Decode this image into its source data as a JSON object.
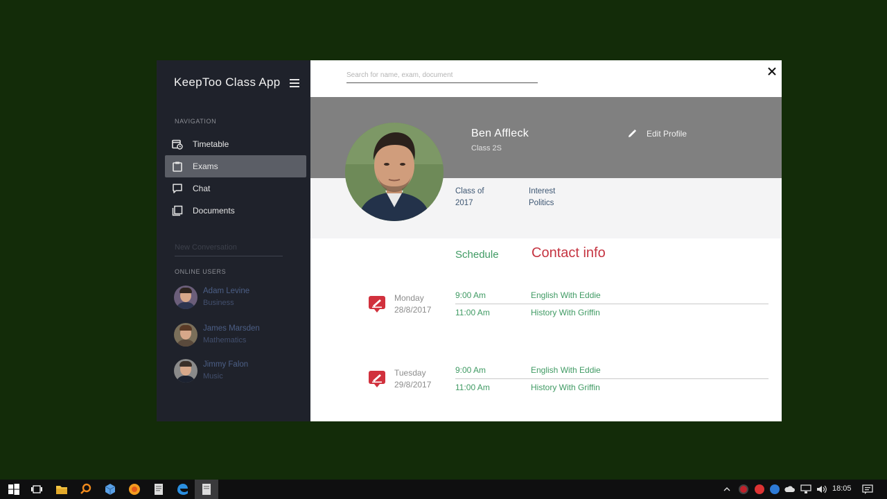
{
  "app": {
    "title": "KeepToo Class App",
    "menu_icon": "hamburger-icon",
    "close_icon": "close-icon"
  },
  "sidebar": {
    "nav_heading": "NAVIGATION",
    "items": [
      {
        "label": "Timetable",
        "icon": "calendar-clock-icon",
        "active": false
      },
      {
        "label": "Exams",
        "icon": "clipboard-icon",
        "active": true
      },
      {
        "label": "Chat",
        "icon": "chat-bubble-icon",
        "active": false
      },
      {
        "label": "Documents",
        "icon": "documents-icon",
        "active": false
      }
    ],
    "new_conversation_placeholder": "New Conversation",
    "online_heading": "ONLINE USERS",
    "users": [
      {
        "name": "Adam Levine",
        "subject": "Business"
      },
      {
        "name": "James Marsden",
        "subject": "Mathematics"
      },
      {
        "name": "Jimmy Falon",
        "subject": "Music"
      }
    ]
  },
  "search": {
    "placeholder": "Search for name, exam, document"
  },
  "profile": {
    "name": "Ben Affleck",
    "class": "Class 2S",
    "edit_label": "Edit Profile",
    "class_of_label": "Class of",
    "class_of_value": "2017",
    "interest_label": "Interest",
    "interest_value": "Politics"
  },
  "tabs": {
    "schedule": "Schedule",
    "contact": "Contact info"
  },
  "schedule": [
    {
      "day": "Monday",
      "date": "28/8/2017",
      "slots": [
        {
          "time": "9:00 Am",
          "subject": "English With Eddie"
        },
        {
          "time": "11:00 Am",
          "subject": "History With Griffin"
        }
      ]
    },
    {
      "day": "Tuesday",
      "date": "29/8/2017",
      "slots": [
        {
          "time": "9:00 Am",
          "subject": "English With Eddie"
        },
        {
          "time": "11:00 Am",
          "subject": "History With Griffin"
        }
      ]
    }
  ],
  "taskbar": {
    "clock": "18:05"
  },
  "colors": {
    "background": "#132c09",
    "sidebar": "#1f222b",
    "profile_band": "#808080",
    "accent_green": "#3f9a63",
    "accent_red": "#c53441"
  }
}
